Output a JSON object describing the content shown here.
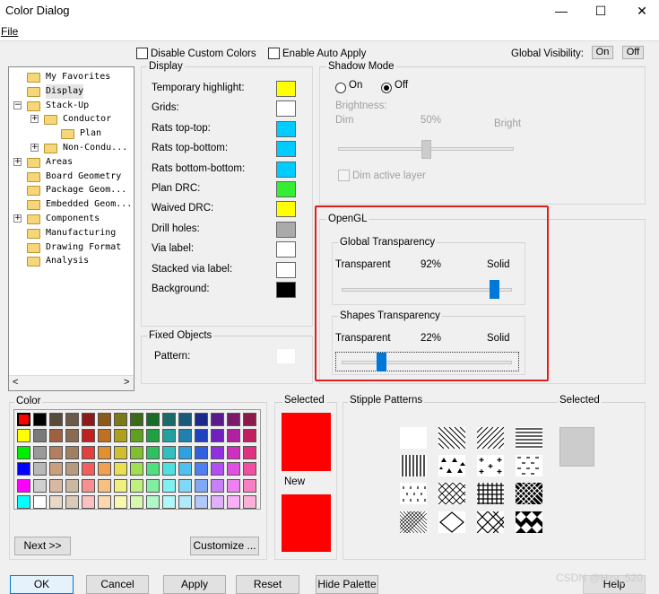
{
  "window": {
    "title": "Color Dialog",
    "minimize": "—",
    "maximize": "☐",
    "close": "✕"
  },
  "menu": {
    "file": "File"
  },
  "top": {
    "disable_custom": "Disable Custom Colors",
    "enable_auto": "Enable Auto Apply",
    "global_visibility": "Global Visibility:",
    "on": "On",
    "off": "Off"
  },
  "tree": {
    "items": [
      {
        "label": "My Favorites",
        "expander": ""
      },
      {
        "label": "Display",
        "expander": ""
      },
      {
        "label": "Stack-Up",
        "expander": "−"
      },
      {
        "label": "Conductor",
        "expander": "+"
      },
      {
        "label": "Plan",
        "expander": ""
      },
      {
        "label": "Non-Condu...",
        "expander": "+"
      },
      {
        "label": "Areas",
        "expander": "+"
      },
      {
        "label": "Board Geometry",
        "expander": ""
      },
      {
        "label": "Package Geom...",
        "expander": ""
      },
      {
        "label": "Embedded Geom...",
        "expander": ""
      },
      {
        "label": "Components",
        "expander": "+"
      },
      {
        "label": "Manufacturing",
        "expander": ""
      },
      {
        "label": "Drawing Format",
        "expander": ""
      },
      {
        "label": "Analysis",
        "expander": ""
      }
    ],
    "scroll_left": "<",
    "scroll_right": ">"
  },
  "display": {
    "title": "Display",
    "items": [
      {
        "label": "Temporary highlight:",
        "color": "#ffff00"
      },
      {
        "label": "Grids:",
        "color": "#ffffff"
      },
      {
        "label": "Rats top-top:",
        "color": "#00ccff"
      },
      {
        "label": "Rats top-bottom:",
        "color": "#00ccff"
      },
      {
        "label": "Rats bottom-bottom:",
        "color": "#00ccff"
      },
      {
        "label": "Plan DRC:",
        "color": "#33ee33"
      },
      {
        "label": "Waived DRC:",
        "color": "#ffff00"
      },
      {
        "label": "Drill holes:",
        "color": "#aaaaaa"
      },
      {
        "label": "Via label:",
        "color": "#ffffff"
      },
      {
        "label": "Stacked via label:",
        "color": "#ffffff"
      },
      {
        "label": "Background:",
        "color": "#000000"
      }
    ]
  },
  "fixed": {
    "title": "Fixed Objects",
    "pattern": "Pattern:"
  },
  "shadow": {
    "title": "Shadow Mode",
    "on": "On",
    "off": "Off",
    "selected": "Off",
    "brightness": "Brightness:",
    "dim": "Dim",
    "value": "50%",
    "bright": "Bright",
    "level": 0.5,
    "dim_active": "Dim active layer"
  },
  "opengl": {
    "title": "OpenGL",
    "global": {
      "title": "Global Transparency",
      "left": "Transparent",
      "value": "92%",
      "right": "Solid",
      "level": 0.92
    },
    "shapes": {
      "title": "Shapes Transparency",
      "left": "Transparent",
      "value": "22%",
      "right": "Solid",
      "level": 0.22
    }
  },
  "color": {
    "title": "Color",
    "next": "Next >>",
    "customize": "Customize ...",
    "selected_index": 0,
    "palette": [
      [
        "#ff0000",
        "#000000",
        "#5a4a3a",
        "#6e5a48",
        "#8b1a1a",
        "#8b5a1a",
        "#7a7a1a",
        "#3a6a1a",
        "#1a6a2a",
        "#1a6a6a",
        "#1a5a7a",
        "#1a2a8b",
        "#5a1a8b",
        "#7a1a6a",
        "#8b1a4a"
      ],
      [
        "#ffff00",
        "#7a7a7a",
        "#a06040",
        "#8a6a50",
        "#c02020",
        "#c07020",
        "#b0a020",
        "#60a020",
        "#20a040",
        "#20a0a0",
        "#2080b0",
        "#2040c0",
        "#7020c0",
        "#b020a0",
        "#c02060"
      ],
      [
        "#00ee00",
        "#9a9a9a",
        "#b08060",
        "#a08060",
        "#e04040",
        "#e09030",
        "#d0c030",
        "#80c030",
        "#30c060",
        "#30c0c0",
        "#30a0e0",
        "#3060e0",
        "#9030e0",
        "#d030c0",
        "#e03080"
      ],
      [
        "#0000ff",
        "#b8b8b8",
        "#c8a080",
        "#b89a80",
        "#f06060",
        "#f0a050",
        "#e8e050",
        "#a0e050",
        "#50e080",
        "#50e0e0",
        "#50c0f0",
        "#5080f0",
        "#b050f0",
        "#e050e0",
        "#f050a0"
      ],
      [
        "#ff00ff",
        "#d0d0d0",
        "#d8b8a0",
        "#cbb8a0",
        "#f89090",
        "#f8c080",
        "#f0f080",
        "#c0f080",
        "#80f0a0",
        "#80f0f0",
        "#80d8f8",
        "#80a8f8",
        "#c880f8",
        "#f080f0",
        "#f880c0"
      ],
      [
        "#00ffff",
        "#ffffff",
        "#e8d8c8",
        "#dccab8",
        "#fcc0c0",
        "#fcd8b0",
        "#f8f8b0",
        "#d8f8b0",
        "#b0f8c8",
        "#b0f8f8",
        "#b0e8fc",
        "#b0c8fc",
        "#e0b0fc",
        "#f8b0f8",
        "#fcb0d8"
      ]
    ]
  },
  "selected": {
    "title": "Selected",
    "new": "New",
    "selected_color": "#ff0000",
    "new_color": "#ff0000"
  },
  "stipple": {
    "title": "Stipple Patterns",
    "selected": "Selected",
    "selected_color": "#cccccc"
  },
  "buttons": {
    "ok": "OK",
    "cancel": "Cancel",
    "apply": "Apply",
    "reset": "Reset",
    "hide": "Hide Palette",
    "help": "Help"
  },
  "watermark": "CSDN @Hzy_520",
  "colors": {
    "highlight_border": "#e02020",
    "accent": "#0078d7"
  }
}
